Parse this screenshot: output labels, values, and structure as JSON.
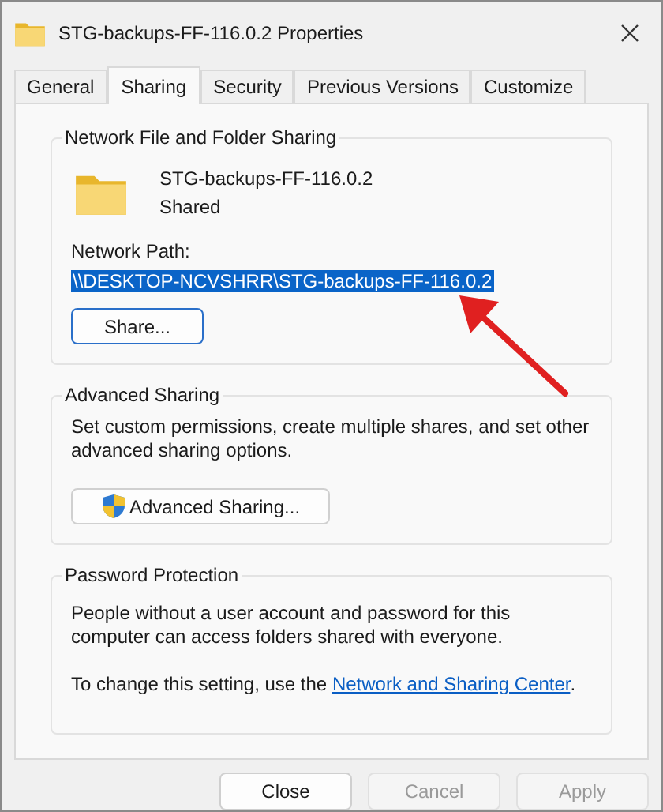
{
  "window": {
    "title": "STG-backups-FF-116.0.2 Properties"
  },
  "tabs": [
    {
      "label": "General",
      "selected": false
    },
    {
      "label": "Sharing",
      "selected": true
    },
    {
      "label": "Security",
      "selected": false
    },
    {
      "label": "Previous Versions",
      "selected": false
    },
    {
      "label": "Customize",
      "selected": false
    }
  ],
  "network_sharing": {
    "heading": "Network File and Folder Sharing",
    "folder_name": "STG-backups-FF-116.0.2",
    "status": "Shared",
    "path_label": "Network Path:",
    "path": {
      "text": "\\\\DESKTOP-NCVSHRR\\STG-backups-FF-116.0.2",
      "selected": true
    },
    "button": "Share..."
  },
  "advanced_sharing": {
    "heading": "Advanced Sharing",
    "description": "Set custom permissions, create multiple shares, and set other advanced sharing options.",
    "button": "Advanced Sharing..."
  },
  "password_protection": {
    "heading": "Password Protection",
    "description": "People without a user account and password for this computer can access folders shared with everyone.",
    "hint_before": "To change this setting, use the ",
    "link": "Network and Sharing Center",
    "hint_after": "."
  },
  "buttons": [
    {
      "label": "Close",
      "disabled": false
    },
    {
      "label": "Cancel",
      "disabled": true
    },
    {
      "label": "Apply",
      "disabled": true
    }
  ]
}
